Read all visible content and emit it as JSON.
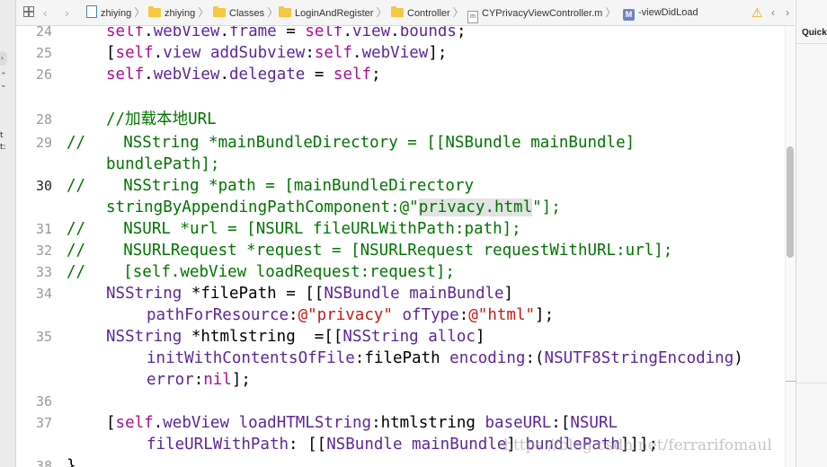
{
  "left_strip": {
    "stepper_icon": "chevron-right-icon",
    "fragments": [
      "t",
      "t:"
    ]
  },
  "jumpbar": {
    "breadcrumbs": [
      {
        "label": "zhiying",
        "icon": "project-icon"
      },
      {
        "label": "zhiying",
        "icon": "folder-icon"
      },
      {
        "label": "Classes",
        "icon": "folder-icon"
      },
      {
        "label": "LoginAndRegister",
        "icon": "folder-icon"
      },
      {
        "label": "Controller",
        "icon": "folder-icon"
      },
      {
        "label": "CYPrivacyViewController.m",
        "icon": "objc-file-icon"
      },
      {
        "label": "-viewDidLoad",
        "icon": "method-icon"
      }
    ],
    "method_badge": "M",
    "file_badge": "m"
  },
  "right_panel": {
    "title": "Quick"
  },
  "editor": {
    "lines": [
      {
        "num": "24"
      },
      {
        "num": "25"
      },
      {
        "num": "26"
      },
      {
        "num": ""
      },
      {
        "num": "28"
      },
      {
        "num": "29"
      },
      {
        "num": ""
      },
      {
        "num": "30"
      },
      {
        "num": ""
      },
      {
        "num": "31"
      },
      {
        "num": "32"
      },
      {
        "num": "33"
      },
      {
        "num": "34"
      },
      {
        "num": ""
      },
      {
        "num": "35"
      },
      {
        "num": ""
      },
      {
        "num": ""
      },
      {
        "num": "36"
      },
      {
        "num": "37"
      },
      {
        "num": ""
      },
      {
        "num": "38"
      }
    ],
    "current_line": "30",
    "code": {
      "l24": "self.webView.frame = self.view.bounds;",
      "l25": "[self.view addSubview:self.webView];",
      "l26": "self.webView.delegate = self;",
      "l28": "//加载本地URL",
      "l29a": "//    NSString *mainBundleDirectory = [[NSBundle mainBundle]",
      "l29b": "bundlePath];",
      "l30a_pre": "//    NSString *path = [mainBundleDirectory",
      "l30b_pre": "stringByAppendingPathComponent:@\"",
      "l30b_sel": "privacy.html",
      "l30b_post": "\"];",
      "l31": "//    NSURL *url = [NSURL fileURLWithPath:path];",
      "l32": "//    NSURLRequest *request = [NSURLRequest requestWithURL:url];",
      "l33": "//    [self.webView loadRequest:request];",
      "l38": "}"
    }
  },
  "watermark": "https://blog.csdn.net/ferrarifomaul",
  "colors": {
    "keyword": "#aa0d91",
    "class": "#5c2699",
    "string": "#c41a16",
    "comment": "#007400",
    "line_number": "#9a9a9a"
  }
}
